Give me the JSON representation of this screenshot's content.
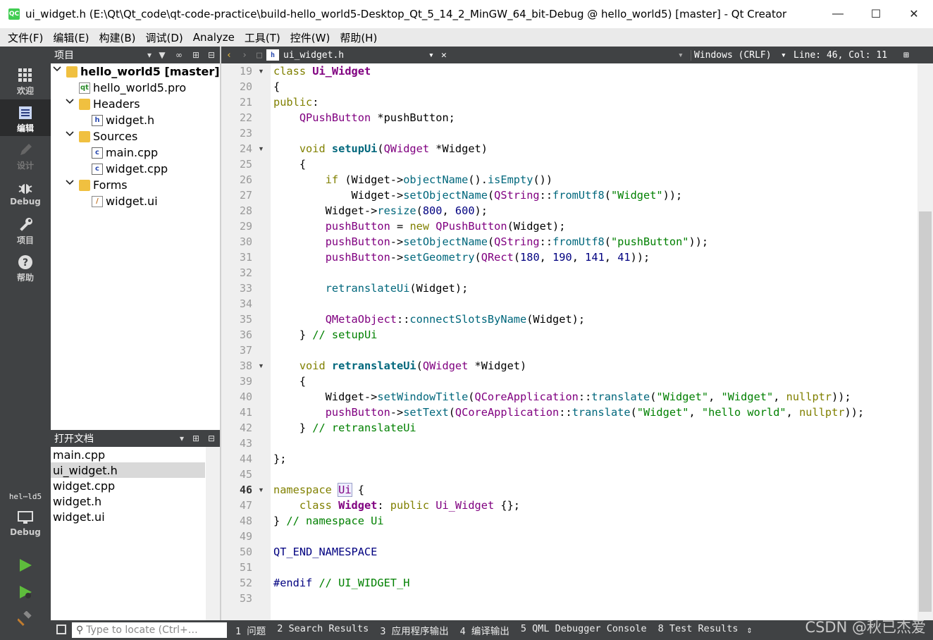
{
  "window": {
    "title": "ui_widget.h (E:\\Qt\\Qt_code\\qt-code-practice\\build-hello_world5-Desktop_Qt_5_14_2_MinGW_64_bit-Debug @ hello_world5) [master] - Qt Creator",
    "logo_text": "QC"
  },
  "menu": {
    "items": [
      {
        "label": "文件(F)"
      },
      {
        "label": "编辑(E)"
      },
      {
        "label": "构建(B)"
      },
      {
        "label": "调试(D)"
      },
      {
        "label": "Analyze"
      },
      {
        "label": "工具(T)"
      },
      {
        "label": "控件(W)"
      },
      {
        "label": "帮助(H)"
      }
    ]
  },
  "modes": [
    {
      "label": "欢迎",
      "icon": "grid-icon"
    },
    {
      "label": "编辑",
      "icon": "edit-doc-icon",
      "active": true
    },
    {
      "label": "设计",
      "icon": "pencil-icon",
      "disabled": true
    },
    {
      "label": "Debug",
      "icon": "bug-icon"
    },
    {
      "label": "项目",
      "icon": "wrench-icon"
    },
    {
      "label": "帮助",
      "icon": "help-icon"
    }
  ],
  "kit": {
    "label": "hel⋯ld5",
    "mode_label": "Debug"
  },
  "project_panel": {
    "title": "项目",
    "tree": [
      {
        "label": "hello_world5 [master]",
        "bold": true,
        "arrow": "⌄",
        "icon": "project-icon"
      },
      {
        "label": "hello_world5.pro",
        "icon": "pro-file-icon"
      },
      {
        "label": "Headers",
        "arrow": "⌄",
        "icon": "folder-icon"
      },
      {
        "label": "widget.h",
        "icon": "header-file-icon"
      },
      {
        "label": "Sources",
        "arrow": "⌄",
        "icon": "folder-icon"
      },
      {
        "label": "main.cpp",
        "icon": "cpp-file-icon"
      },
      {
        "label": "widget.cpp",
        "icon": "cpp-file-icon"
      },
      {
        "label": "Forms",
        "arrow": "⌄",
        "icon": "folder-icon"
      },
      {
        "label": "widget.ui",
        "icon": "ui-file-icon"
      }
    ]
  },
  "open_docs": {
    "title": "打开文档",
    "items": [
      {
        "label": "main.cpp"
      },
      {
        "label": "ui_widget.h",
        "selected": true
      },
      {
        "label": "widget.cpp"
      },
      {
        "label": "widget.h"
      },
      {
        "label": "widget.ui"
      }
    ]
  },
  "editor": {
    "file_name": "ui_widget.h",
    "line_ending": "Windows (CRLF)",
    "position": "Line: 46, Col: 11",
    "current_line": 46,
    "lines": [
      {
        "n": 19,
        "fold": true,
        "tokens": [
          [
            "kw",
            "class "
          ],
          [
            "ty",
            "Ui_Widget"
          ]
        ]
      },
      {
        "n": 20,
        "tokens": [
          [
            "",
            "{"
          ]
        ]
      },
      {
        "n": 21,
        "tokens": [
          [
            "kw",
            "public"
          ],
          [
            "",
            ":"
          ]
        ]
      },
      {
        "n": 22,
        "tokens": [
          [
            "",
            "    "
          ],
          [
            "ty",
            "QPushButton"
          ],
          [
            "",
            " *pushButton;"
          ]
        ]
      },
      {
        "n": 23,
        "tokens": []
      },
      {
        "n": 24,
        "fold": true,
        "tokens": [
          [
            "",
            "    "
          ],
          [
            "kw",
            "void "
          ],
          [
            "fnb",
            "setupUi"
          ],
          [
            "",
            "("
          ],
          [
            "ty",
            "QWidget"
          ],
          [
            "",
            " *Widget)"
          ]
        ]
      },
      {
        "n": 25,
        "tokens": [
          [
            "",
            "    {"
          ]
        ]
      },
      {
        "n": 26,
        "tokens": [
          [
            "",
            "        "
          ],
          [
            "kw",
            "if "
          ],
          [
            "",
            "(Widget->"
          ],
          [
            "fn",
            "objectName"
          ],
          [
            "",
            "()."
          ],
          [
            "fn",
            "isEmpty"
          ],
          [
            "",
            "())"
          ]
        ]
      },
      {
        "n": 27,
        "tokens": [
          [
            "",
            "            Widget->"
          ],
          [
            "fn",
            "setObjectName"
          ],
          [
            "",
            "("
          ],
          [
            "ty",
            "QString"
          ],
          [
            "",
            "::"
          ],
          [
            "fn",
            "fromUtf8"
          ],
          [
            "",
            "("
          ],
          [
            "st",
            "\"Widget\""
          ],
          [
            "",
            "));"
          ]
        ]
      },
      {
        "n": 28,
        "tokens": [
          [
            "",
            "        Widget->"
          ],
          [
            "fn",
            "resize"
          ],
          [
            "",
            "("
          ],
          [
            "nm",
            "800"
          ],
          [
            "",
            ", "
          ],
          [
            "nm",
            "600"
          ],
          [
            "",
            ");"
          ]
        ]
      },
      {
        "n": 29,
        "tokens": [
          [
            "",
            "        "
          ],
          [
            "ty",
            "pushButton"
          ],
          [
            "",
            " = "
          ],
          [
            "kw",
            "new "
          ],
          [
            "ty",
            "QPushButton"
          ],
          [
            "",
            "(Widget);"
          ]
        ]
      },
      {
        "n": 30,
        "tokens": [
          [
            "",
            "        "
          ],
          [
            "ty",
            "pushButton"
          ],
          [
            "",
            "->"
          ],
          [
            "fn",
            "setObjectName"
          ],
          [
            "",
            "("
          ],
          [
            "ty",
            "QString"
          ],
          [
            "",
            "::"
          ],
          [
            "fn",
            "fromUtf8"
          ],
          [
            "",
            "("
          ],
          [
            "st",
            "\"pushButton\""
          ],
          [
            "",
            "));"
          ]
        ]
      },
      {
        "n": 31,
        "tokens": [
          [
            "",
            "        "
          ],
          [
            "ty",
            "pushButton"
          ],
          [
            "",
            "->"
          ],
          [
            "fn",
            "setGeometry"
          ],
          [
            "",
            "("
          ],
          [
            "ty",
            "QRect"
          ],
          [
            "",
            "("
          ],
          [
            "nm",
            "180"
          ],
          [
            "",
            ", "
          ],
          [
            "nm",
            "190"
          ],
          [
            "",
            ", "
          ],
          [
            "nm",
            "141"
          ],
          [
            "",
            ", "
          ],
          [
            "nm",
            "41"
          ],
          [
            "",
            "));"
          ]
        ]
      },
      {
        "n": 32,
        "tokens": []
      },
      {
        "n": 33,
        "tokens": [
          [
            "",
            "        "
          ],
          [
            "fn",
            "retranslateUi"
          ],
          [
            "",
            "(Widget);"
          ]
        ]
      },
      {
        "n": 34,
        "tokens": []
      },
      {
        "n": 35,
        "tokens": [
          [
            "",
            "        "
          ],
          [
            "ty",
            "QMetaObject"
          ],
          [
            "",
            "::"
          ],
          [
            "fn",
            "connectSlotsByName"
          ],
          [
            "",
            "(Widget);"
          ]
        ]
      },
      {
        "n": 36,
        "tokens": [
          [
            "",
            "    } "
          ],
          [
            "cm",
            "// setupUi"
          ]
        ]
      },
      {
        "n": 37,
        "tokens": []
      },
      {
        "n": 38,
        "fold": true,
        "tokens": [
          [
            "",
            "    "
          ],
          [
            "kw",
            "void "
          ],
          [
            "fnb",
            "retranslateUi"
          ],
          [
            "",
            "("
          ],
          [
            "ty",
            "QWidget"
          ],
          [
            "",
            " *Widget)"
          ]
        ]
      },
      {
        "n": 39,
        "tokens": [
          [
            "",
            "    {"
          ]
        ]
      },
      {
        "n": 40,
        "tokens": [
          [
            "",
            "        Widget->"
          ],
          [
            "fn",
            "setWindowTitle"
          ],
          [
            "",
            "("
          ],
          [
            "ty",
            "QCoreApplication"
          ],
          [
            "",
            "::"
          ],
          [
            "fn",
            "translate"
          ],
          [
            "",
            "("
          ],
          [
            "st",
            "\"Widget\""
          ],
          [
            "",
            ", "
          ],
          [
            "st",
            "\"Widget\""
          ],
          [
            "",
            ", "
          ],
          [
            "kw",
            "nullptr"
          ],
          [
            "",
            "));"
          ]
        ]
      },
      {
        "n": 41,
        "tokens": [
          [
            "",
            "        "
          ],
          [
            "ty",
            "pushButton"
          ],
          [
            "",
            "->"
          ],
          [
            "fn",
            "setText"
          ],
          [
            "",
            "("
          ],
          [
            "ty",
            "QCoreApplication"
          ],
          [
            "",
            "::"
          ],
          [
            "fn",
            "translate"
          ],
          [
            "",
            "("
          ],
          [
            "st",
            "\"Widget\""
          ],
          [
            "",
            ", "
          ],
          [
            "st",
            "\"hello world\""
          ],
          [
            "",
            ", "
          ],
          [
            "kw",
            "nullptr"
          ],
          [
            "",
            "));"
          ]
        ]
      },
      {
        "n": 42,
        "tokens": [
          [
            "",
            "    } "
          ],
          [
            "cm",
            "// retranslateUi"
          ]
        ]
      },
      {
        "n": 43,
        "tokens": []
      },
      {
        "n": 44,
        "tokens": [
          [
            "",
            "};"
          ]
        ]
      },
      {
        "n": 45,
        "tokens": []
      },
      {
        "n": 46,
        "fold": true,
        "tokens": [
          [
            "kw",
            "namespace "
          ],
          [
            "tyc",
            "Ui"
          ],
          [
            "",
            " {"
          ]
        ]
      },
      {
        "n": 47,
        "tokens": [
          [
            "",
            "    "
          ],
          [
            "kw",
            "class "
          ],
          [
            "tyb",
            "Widget"
          ],
          [
            "",
            ": "
          ],
          [
            "kw",
            "public "
          ],
          [
            "ty",
            "Ui_Widget"
          ],
          [
            "",
            " {};"
          ]
        ]
      },
      {
        "n": 48,
        "tokens": [
          [
            "",
            "} "
          ],
          [
            "cm",
            "// namespace Ui"
          ]
        ]
      },
      {
        "n": 49,
        "tokens": []
      },
      {
        "n": 50,
        "tokens": [
          [
            "mc",
            "QT_END_NAMESPACE"
          ]
        ]
      },
      {
        "n": 51,
        "tokens": []
      },
      {
        "n": 52,
        "tokens": [
          [
            "mc",
            "#endif "
          ],
          [
            "cm",
            "// UI_WIDGET_H"
          ]
        ]
      },
      {
        "n": 53,
        "tokens": []
      }
    ]
  },
  "statusbar": {
    "locator_placeholder": "Type to locate (Ctrl+…",
    "tabs": [
      {
        "label": "1 问题"
      },
      {
        "label": "2 Search Results"
      },
      {
        "label": "3 应用程序输出"
      },
      {
        "label": "4 编译输出"
      },
      {
        "label": "5 QML Debugger Console"
      },
      {
        "label": "8 Test Results"
      }
    ]
  },
  "watermark": "CSDN @秋已杰爱",
  "colors": {
    "sidebar": "#404244",
    "keyword": "#808000",
    "type": "#800080",
    "function": "#00677c",
    "string": "#008000"
  }
}
